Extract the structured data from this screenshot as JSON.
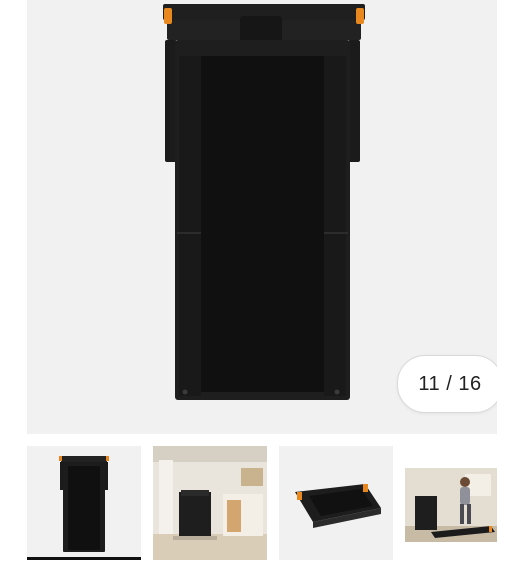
{
  "gallery": {
    "current": 11,
    "total": 16,
    "counter_text": "11 / 16",
    "main_image": {
      "subject": "treadmill-top-view",
      "colors": {
        "frame": "#1b1b1b",
        "belt": "#121212",
        "accent": "#e8881f",
        "background": "#f1f1f1"
      }
    },
    "thumbnails": [
      {
        "subject": "treadmill-top-view",
        "active": true
      },
      {
        "subject": "treadmill-in-living-room",
        "active": false
      },
      {
        "subject": "treadmill-folded-angle",
        "active": false
      },
      {
        "subject": "woman-walking-on-treadmill",
        "active": false
      }
    ]
  }
}
